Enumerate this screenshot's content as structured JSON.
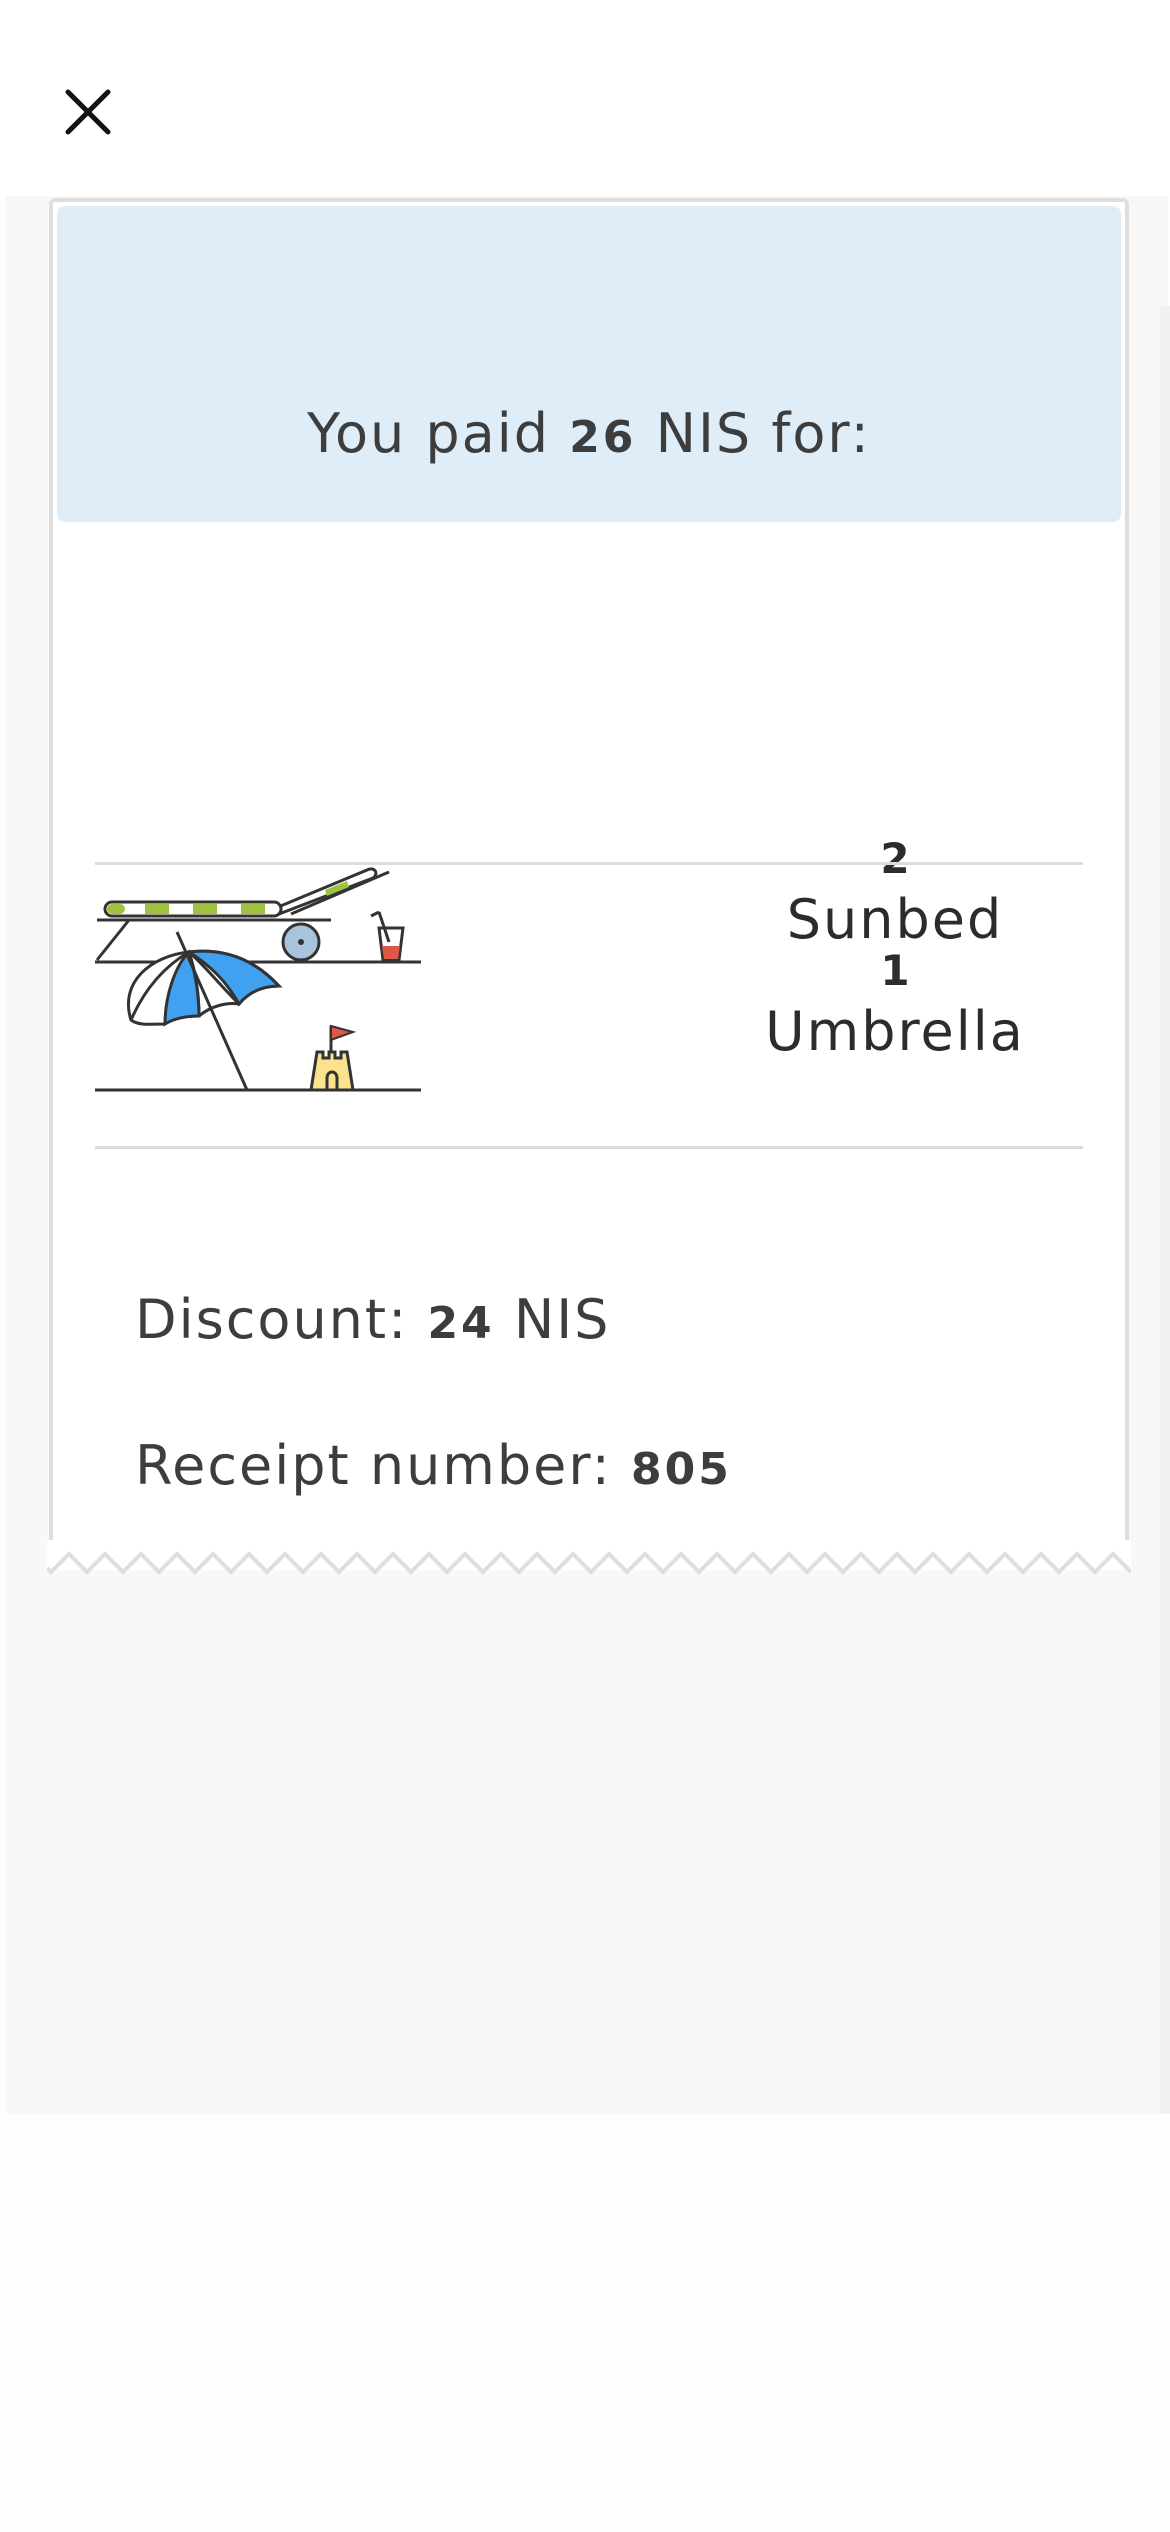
{
  "header": {
    "close_icon": "close-icon"
  },
  "receipt": {
    "paid_prefix": "You paid",
    "paid_amount": "26",
    "paid_suffix": "NIS for:",
    "items": [
      {
        "quantity": "2",
        "label": "Sunbed",
        "icon": "sunbed-icon"
      },
      {
        "quantity": "1",
        "label": "Umbrella",
        "icon": "umbrella-icon"
      }
    ],
    "discount_label": "Discount:",
    "discount_amount": "24",
    "discount_currency": "NIS",
    "receipt_number_label": "Receipt number:",
    "receipt_number": "805"
  },
  "colors": {
    "header_bg": "#deedf7",
    "panel_bg": "#f8f8f8",
    "umbrella_blue": "#3fa1ef",
    "sunbed_green": "#9fc340",
    "castle_yellow": "#fde28e",
    "flag_red": "#dc5a45"
  }
}
